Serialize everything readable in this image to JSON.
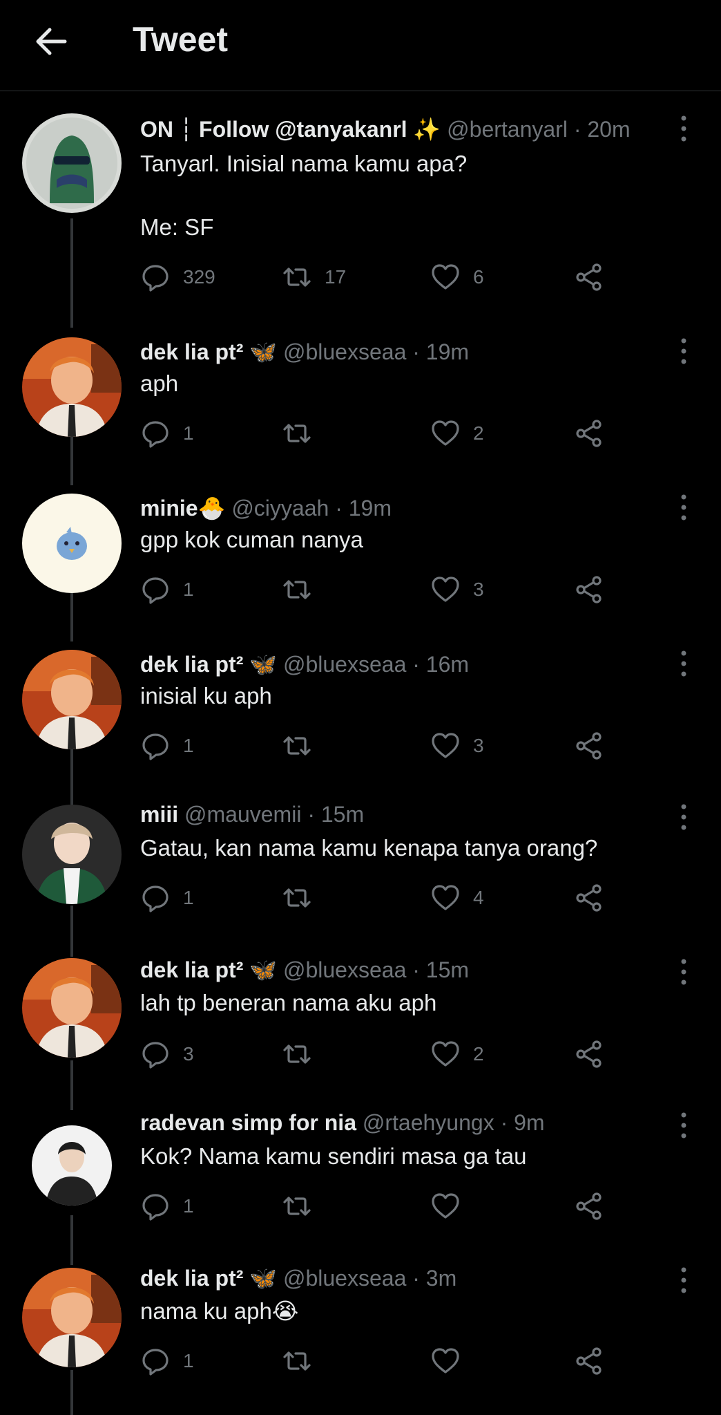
{
  "header": {
    "title": "Tweet"
  },
  "tweets": [
    {
      "name": "ON ┆ Follow @tanyakanrl ✨",
      "handle": "@bertanyarl",
      "time": "· 20m",
      "text": "Tanyarl. Inisial nama kamu apa?\n\nMe: SF",
      "replies": "329",
      "retweets": "17",
      "likes": "6"
    },
    {
      "name": "dek lia pt² 🦋",
      "handle": "@bluexseaa",
      "time": "· 19m",
      "text": "aph",
      "replies": "1",
      "retweets": "",
      "likes": "2"
    },
    {
      "name": "minie🐣",
      "handle": "@ciyyaah",
      "time": "· 19m",
      "text": "gpp kok cuman nanya",
      "replies": "1",
      "retweets": "",
      "likes": "3"
    },
    {
      "name": "dek lia pt² 🦋",
      "handle": "@bluexseaa",
      "time": "· 16m",
      "text": "inisial ku aph",
      "replies": "1",
      "retweets": "",
      "likes": "3"
    },
    {
      "name": "miii",
      "handle": "@mauvemii",
      "time": "· 15m",
      "text": "Gatau, kan nama kamu kenapa tanya orang?",
      "replies": "1",
      "retweets": "",
      "likes": "4"
    },
    {
      "name": "dek lia pt² 🦋",
      "handle": "@bluexseaa",
      "time": "· 15m",
      "text": "lah tp beneran nama aku aph",
      "replies": "3",
      "retweets": "",
      "likes": "2"
    },
    {
      "name": "radevan simp for nia",
      "handle": "@rtaehyungx",
      "time": "· 9m",
      "text": "Kok? Nama kamu sendiri masa ga tau",
      "replies": "1",
      "retweets": "",
      "likes": ""
    },
    {
      "name": "dek lia pt² 🦋",
      "handle": "@bluexseaa",
      "time": "· 3m",
      "text": "nama ku aph😭",
      "replies": "1",
      "retweets": "",
      "likes": ""
    }
  ],
  "colors": {
    "background": "#000000",
    "text": "#e7e9ea",
    "muted": "#71767b",
    "line": "#333639"
  }
}
